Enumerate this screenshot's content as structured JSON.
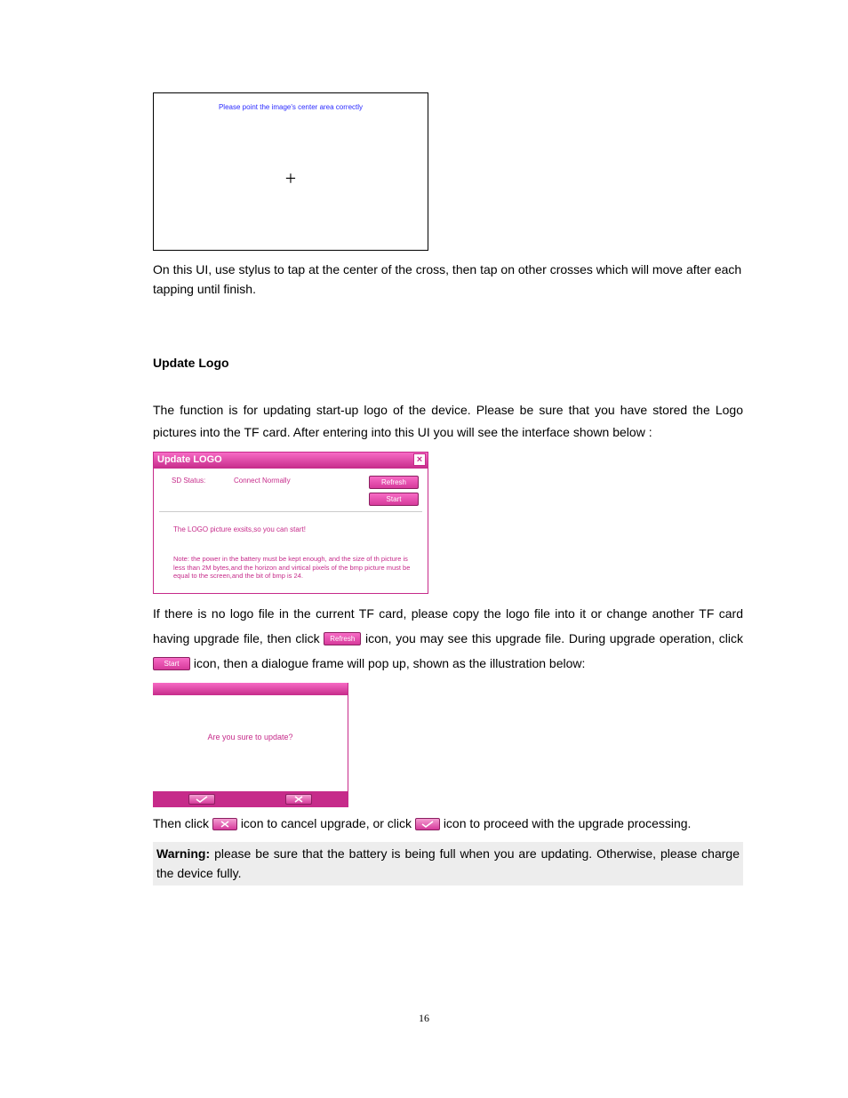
{
  "calibration": {
    "instruction": "Please point the  image's center area correctly"
  },
  "para_calibration_usage": "On this UI, use stylus to tap at the center of the cross, then tap on other crosses which will move after each tapping until finish.",
  "section_title": "Update Logo",
  "para_intro": "The function is for updating start-up logo of the device. Please be sure that you have stored the Logo pictures into the TF card. After entering into this UI you will see the interface shown below :",
  "update_logo_window": {
    "title": "Update LOGO",
    "sd_status_label": "SD Status:",
    "sd_status_value": "Connect Normally",
    "btn_refresh": "Refresh",
    "btn_start": "Start",
    "msg_exists": "The LOGO picture exsits,so you can start!",
    "note": "Note: the power in the battery must be kept enough, and the size of th picture is less than 2M bytes,and the horizon and virtical pixels of the bmp picture must be equal to the screen,and the bit of bmp is 24."
  },
  "para_after_window_1a": "If there is no logo file in the current TF card, please copy the logo file into it or change another TF card having upgrade file, then click ",
  "para_after_window_1b": " icon, you may see this upgrade file. During upgrade operation, click",
  "para_after_window_1c": " icon, then a dialogue frame will pop up, shown as the illustration below:",
  "inline_refresh": "Refresh",
  "inline_start": "Start",
  "confirm_dialog": {
    "text": "Are you sure to update?"
  },
  "para_then_click_a": "Then click ",
  "para_then_click_b": "icon to cancel upgrade, or click ",
  "para_then_click_c": " icon to proceed with the upgrade processing.",
  "warning_label": "Warning:",
  "warning_text": " please be sure that the battery is being full when you are updating. Otherwise, please charge the device fully.",
  "page_number": "16"
}
